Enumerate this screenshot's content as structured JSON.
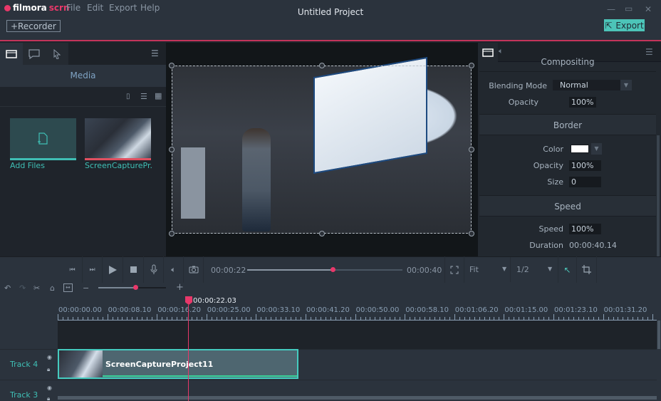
{
  "app": {
    "logo_main": "filmora",
    "logo_accent": "scrn",
    "title": "Untitled Project",
    "menu": [
      "File",
      "Edit",
      "Export",
      "Help"
    ],
    "recorder_label": "+Recorder",
    "export_label": "Export",
    "window_controls": [
      "minimize-icon",
      "maximize-icon",
      "close-icon"
    ],
    "accent_color": "#e8386a",
    "teal_color": "#4cc4b8"
  },
  "left_panel": {
    "tabs": [
      "media-icon",
      "annotation-icon",
      "cursor-icon"
    ],
    "section_title": "Media",
    "view_icons": [
      "new-file-icon",
      "list-view-icon",
      "grid-view-icon"
    ],
    "items": [
      {
        "label": "Add Files",
        "type": "add"
      },
      {
        "label": "ScreenCapturePr...",
        "type": "clip"
      }
    ]
  },
  "right_panel": {
    "tabs": [
      "video-icon",
      "audio-icon"
    ],
    "compositing": {
      "title": "Compositing",
      "blending_mode_label": "Blending Mode",
      "blending_mode_value": "Normal",
      "opacity_label": "Opacity",
      "opacity_value": "100%"
    },
    "border": {
      "title": "Border",
      "color_label": "Color",
      "color_value": "#ffffff",
      "opacity_label": "Opacity",
      "opacity_value": "100%",
      "size_label": "Size",
      "size_value": "0"
    },
    "speed": {
      "title": "Speed",
      "speed_label": "Speed",
      "speed_value": "100%",
      "duration_label": "Duration",
      "duration_value": "00:00:40.14"
    }
  },
  "player": {
    "current_time": "00:00:22",
    "total_time": "00:00:40",
    "progress": 0.55,
    "fit_value": "Fit",
    "quality_value": "1/2"
  },
  "toolbar": {
    "zoom_minus": "−",
    "zoom_plus": "+",
    "zoom_level": 0.55
  },
  "timeline": {
    "playhead_time": "00:00:22.03",
    "ruler_labels": [
      "00:00:00.00",
      "00:00:08.10",
      "00:00:16.20",
      "00:00:25.00",
      "00:00:33.10",
      "00:00:41.20",
      "00:00:50.00",
      "00:00:58.10",
      "00:01:06.20",
      "00:01:15.00",
      "00:01:23.10",
      "00:01:31.20"
    ],
    "tracks": [
      {
        "label": "Track 4",
        "clip": "ScreenCaptureProject11"
      },
      {
        "label": "Track 3",
        "clip": ""
      }
    ]
  }
}
